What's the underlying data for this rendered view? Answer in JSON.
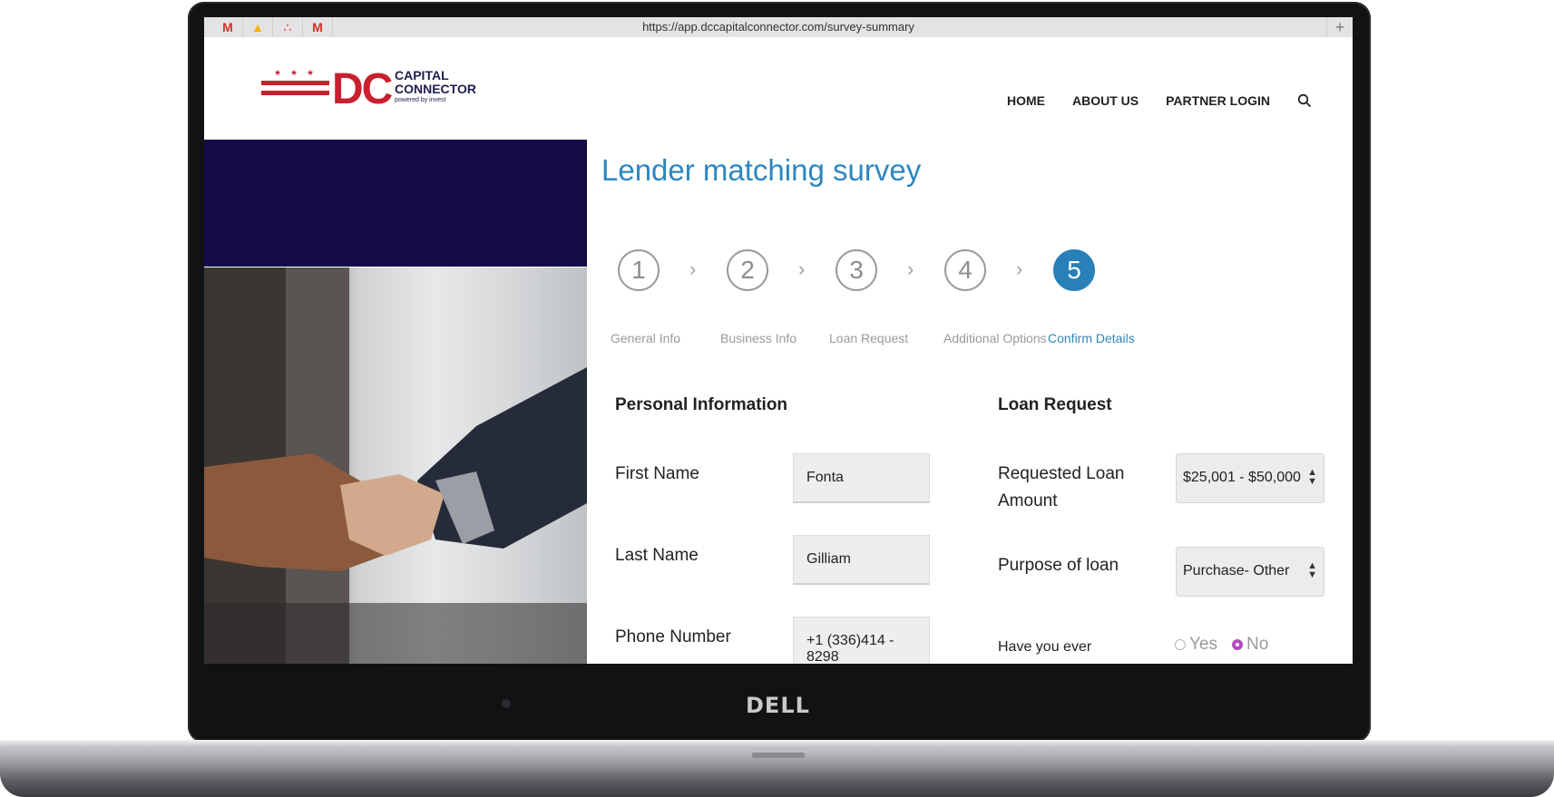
{
  "browser": {
    "url": "https://app.dccapitalconnector.com/survey-summary",
    "tabs": [
      "M",
      "▲",
      "∴",
      "M"
    ]
  },
  "logo": {
    "mark": "DC",
    "line1": "CAPITAL",
    "line2": "CONNECTOR",
    "tagline": "powered by invest"
  },
  "nav": {
    "items": [
      "HOME",
      "ABOUT US",
      "PARTNER LOGIN"
    ]
  },
  "survey": {
    "title": "Lender matching survey",
    "steps": [
      {
        "num": "1",
        "label": "General Info"
      },
      {
        "num": "2",
        "label": "Business Info"
      },
      {
        "num": "3",
        "label": "Loan Request"
      },
      {
        "num": "4",
        "label": "Additional Options"
      },
      {
        "num": "5",
        "label": "Confirm Details"
      }
    ],
    "active_step": 5
  },
  "personal": {
    "heading": "Personal Information",
    "first_name_label": "First Name",
    "first_name": "Fonta",
    "last_name_label": "Last Name",
    "last_name": "Gilliam",
    "phone_label": "Phone Number",
    "phone": "+1 (336)414 - 8298"
  },
  "loan": {
    "heading": "Loan Request",
    "amount_label": "Requested Loan Amount",
    "amount": "$25,001 - $50,000",
    "purpose_label": "Purpose of loan",
    "purpose": "Purchase- Other",
    "question_label": "Have you ever",
    "yes": "Yes",
    "no": "No"
  },
  "device": {
    "brand": "DELL"
  },
  "colors": {
    "accent_blue": "#2e86c1",
    "navy": "#130c47",
    "brand_red": "#c8202f",
    "radio_purple": "#b14bbf"
  }
}
